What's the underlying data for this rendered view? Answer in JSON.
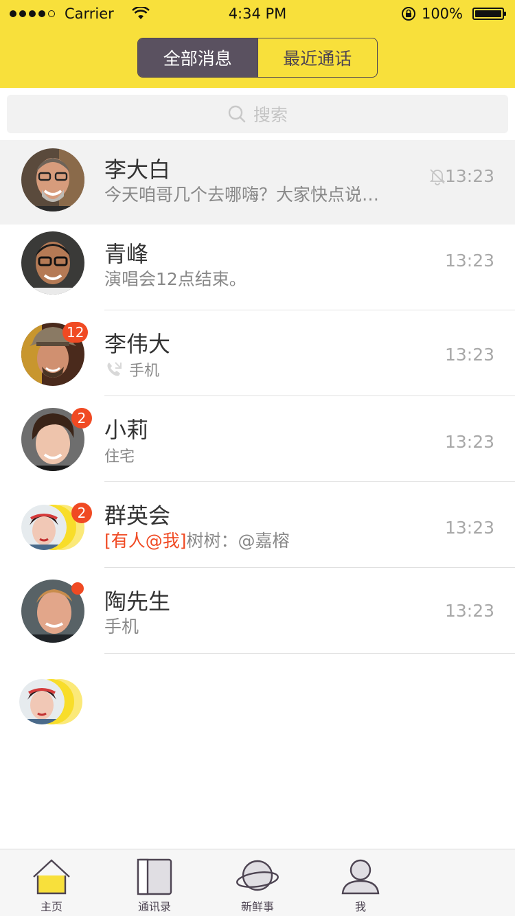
{
  "status": {
    "carrier": "Carrier",
    "time": "4:34 PM",
    "battery": "100%"
  },
  "segmented": {
    "active": "全部消息",
    "inactive": "最近通话"
  },
  "search": {
    "placeholder": "搜索"
  },
  "conversations": [
    {
      "name": "李大白",
      "preview": "今天咱哥几个去哪嗨？大家快点说…",
      "time": "13:23",
      "muted": true
    },
    {
      "name": "青峰",
      "preview": "演唱会12点结束。",
      "time": "13:23"
    },
    {
      "name": "李伟大",
      "preview": "手机",
      "time": "13:23",
      "badge": "12"
    },
    {
      "name": "小莉",
      "preview": "住宅",
      "time": "13:23",
      "badge": "2"
    },
    {
      "name": "群英会",
      "mention": "[有人@我]",
      "preview": "树树：@嘉榕",
      "time": "13:23",
      "badge": "2"
    },
    {
      "name": "陶先生",
      "preview": "手机",
      "time": "13:23",
      "dot": true
    }
  ],
  "tabs": [
    {
      "label": "主页",
      "icon": "home-icon"
    },
    {
      "label": "通讯录",
      "icon": "contacts-icon"
    },
    {
      "label": "新鲜事",
      "icon": "planet-icon"
    },
    {
      "label": "我",
      "icon": "person-icon"
    }
  ],
  "colors": {
    "accent_yellow": "#f8e03b",
    "segment_dark": "#5a5160",
    "badge_red": "#f04a23"
  }
}
